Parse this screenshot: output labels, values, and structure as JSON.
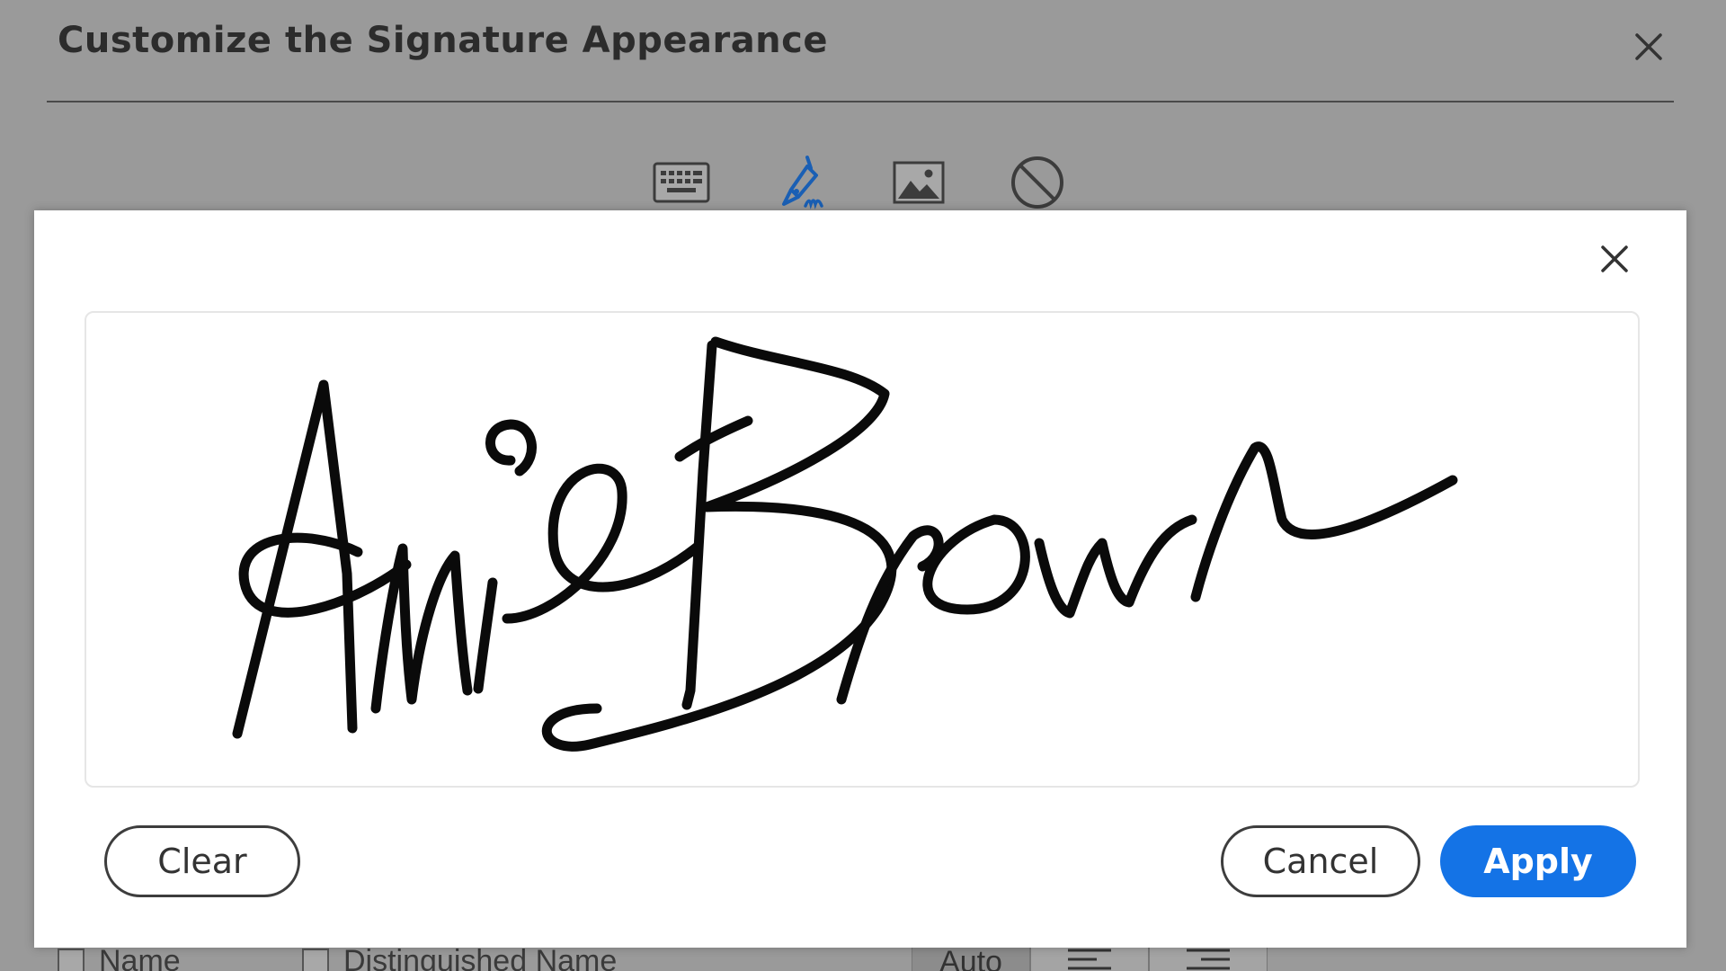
{
  "background_dialog": {
    "title": "Customize the Signature Appearance",
    "toolbar": {
      "tools": [
        {
          "name": "type",
          "icon": "keyboard-icon"
        },
        {
          "name": "draw",
          "icon": "pen-draw-icon",
          "active": true
        },
        {
          "name": "image",
          "icon": "image-icon"
        },
        {
          "name": "none",
          "icon": "no-symbol-icon"
        }
      ]
    },
    "bottom_row": {
      "checkbox_name_label": "Name",
      "checkbox_dn_label": "Distinguished Name",
      "alignment_auto_label": "Auto"
    }
  },
  "draw_panel": {
    "signature_text": "Annie Brown",
    "buttons": {
      "clear_label": "Clear",
      "cancel_label": "Cancel",
      "apply_label": "Apply"
    }
  },
  "colors": {
    "accent": "#1473e6",
    "active_tool": "#1a5fb4",
    "overlay": "#9a9a9a",
    "ink": "#0a0a0a"
  }
}
